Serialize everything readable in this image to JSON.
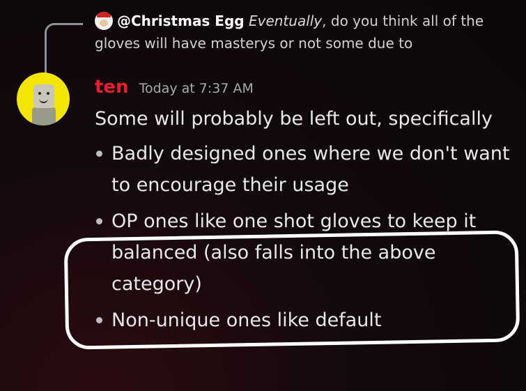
{
  "reply": {
    "author": "@Christmas Egg",
    "lead": "Eventually",
    "rest": ", do you think all of the gloves will have masterys or not some due to"
  },
  "message": {
    "username": "ten",
    "timestamp": "Today at 7:37 AM",
    "intro": "Some will probably be left out, specifically",
    "bullets": [
      "Badly designed ones where we don't want to encourage their usage",
      "OP ones like one shot gloves to keep it balanced (also falls into the above category)",
      "Non-unique ones like default"
    ]
  },
  "icons": {
    "reply_avatar": "christmas-egg-avatar-icon",
    "user_avatar": "roblox-avatar-icon",
    "bullet": "bullet-dot-icon"
  },
  "colors": {
    "username": "#ee1b2d",
    "avatar_background": "#f4e600",
    "annotation": "#ffffff"
  }
}
